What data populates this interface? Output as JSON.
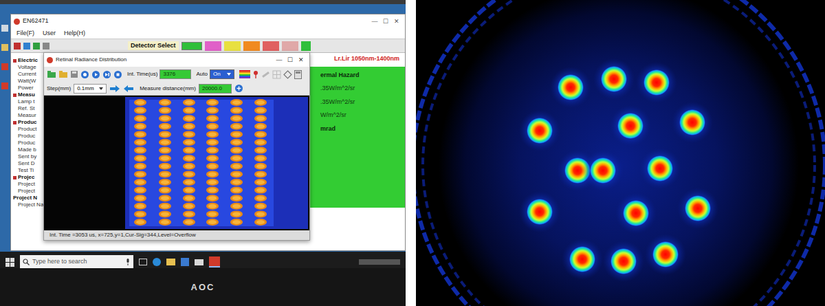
{
  "main_window": {
    "title": "EN62471",
    "window_buttons": [
      "—",
      "☐",
      "✕"
    ],
    "menu": [
      "File(F)",
      "User",
      "Help(H)"
    ],
    "toolbar": {
      "label": "Detector Select"
    },
    "range_label": "Lr.Lir 1050nm-1400nm",
    "tree": [
      {
        "text": "Electric",
        "kind": "group"
      },
      {
        "text": "Voltage",
        "kind": "item"
      },
      {
        "text": "Current",
        "kind": "item"
      },
      {
        "text": "Watt(W",
        "kind": "item"
      },
      {
        "text": "Power",
        "kind": "item"
      },
      {
        "text": "Measu",
        "kind": "group"
      },
      {
        "text": "Lamp t",
        "kind": "item"
      },
      {
        "text": "Ref. St",
        "kind": "item"
      },
      {
        "text": "Measur",
        "kind": "item"
      },
      {
        "text": "Produc",
        "kind": "group"
      },
      {
        "text": "Product",
        "kind": "item"
      },
      {
        "text": "Produc",
        "kind": "item"
      },
      {
        "text": "Produc",
        "kind": "item"
      },
      {
        "text": "Made b",
        "kind": "item"
      },
      {
        "text": "Sent by",
        "kind": "item"
      },
      {
        "text": "Sent D",
        "kind": "item"
      },
      {
        "text": "Test Ti",
        "kind": "item"
      },
      {
        "text": "Projec",
        "kind": "group"
      },
      {
        "text": "Project",
        "kind": "item"
      },
      {
        "text": "Project",
        "kind": "item"
      },
      {
        "text": "Project N",
        "kind": "label"
      },
      {
        "text": "Project Na",
        "kind": "item"
      }
    ],
    "result_panel": [
      {
        "text": "ermal Hazard",
        "kind": "heading"
      },
      {
        "text": ".35W/m^2/sr",
        "kind": "value"
      },
      {
        "text": ".35W/m^2/sr",
        "kind": "value"
      },
      {
        "text": "W/m^2/sr",
        "kind": "value"
      },
      {
        "text": "mrad",
        "kind": "heading"
      }
    ]
  },
  "dialog": {
    "title": "Retinal Radiance Distribution",
    "window_buttons": [
      "—",
      "☐",
      "✕"
    ],
    "int_time": {
      "label": "Int. Time(us)",
      "value": "3376"
    },
    "auto": {
      "label": "Auto",
      "value": "On"
    },
    "step": {
      "label": "Step(mm)",
      "value": "0.1mm"
    },
    "measure_distance": {
      "label": "Measure distance(mm)",
      "value": "20000.0"
    },
    "status": "Int. Time =3053 us, x=725,y=1,Cur-Sig=344,Level=Overflow"
  },
  "taskbar": {
    "search_placeholder": "Type here to search"
  },
  "monitor": {
    "brand": "AOC"
  }
}
